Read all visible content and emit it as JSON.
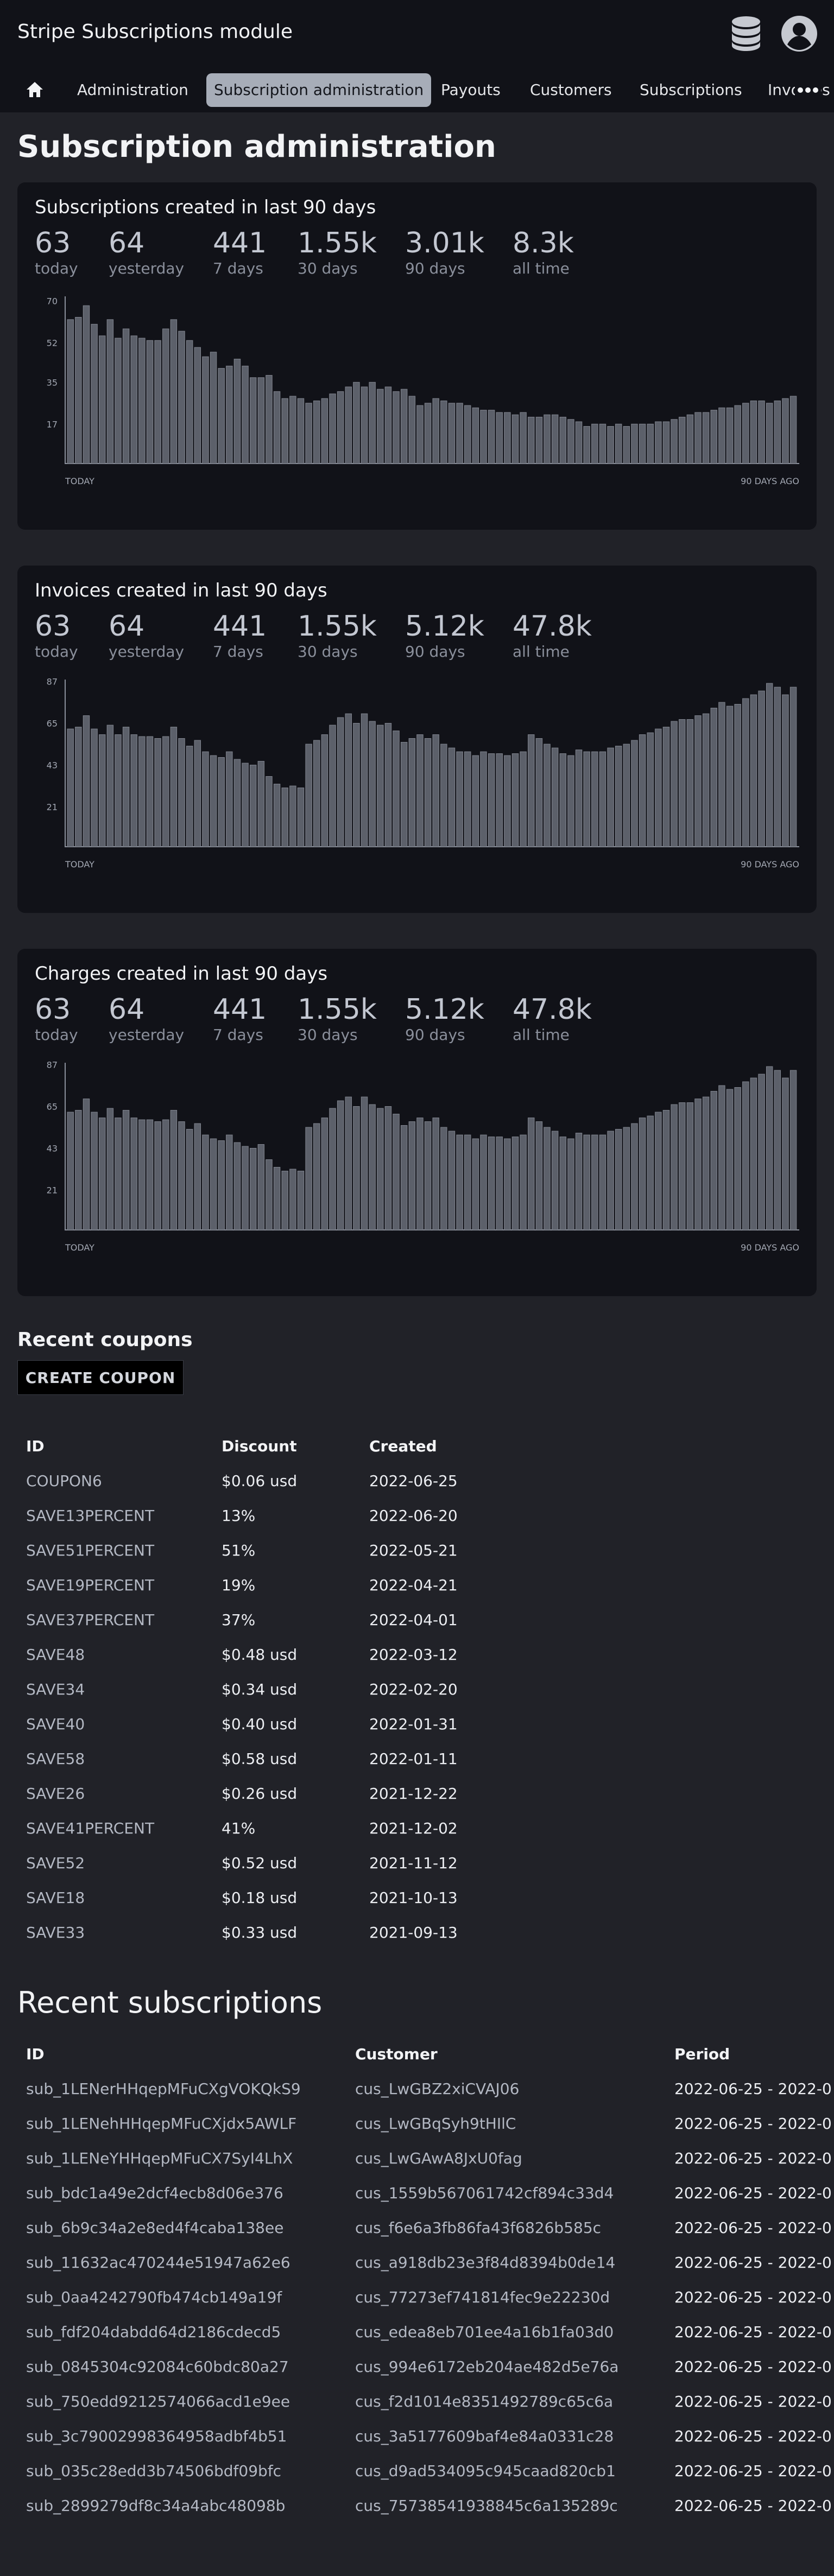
{
  "app": {
    "title": "Stripe Subscriptions module"
  },
  "icons": {
    "database": "database-icon",
    "account": "account-circle-icon",
    "home": "home-icon",
    "more": "more-horizontal-icon"
  },
  "nav": {
    "tabs": [
      "Administration",
      "Subscription administration",
      "Payouts",
      "Customers",
      "Subscriptions",
      "Invoices"
    ],
    "active_index": 1
  },
  "page": {
    "title": "Subscription administration"
  },
  "cards": [
    {
      "title": "Subscriptions created in last 90 days",
      "stats": [
        {
          "value": "63",
          "label": "today"
        },
        {
          "value": "64",
          "label": "yesterday"
        },
        {
          "value": "441",
          "label": "7 days"
        },
        {
          "value": "1.55k",
          "label": "30 days"
        },
        {
          "value": "3.01k",
          "label": "90 days"
        },
        {
          "value": "8.3k",
          "label": "all time"
        }
      ]
    },
    {
      "title": "Invoices created in last 90 days",
      "stats": [
        {
          "value": "63",
          "label": "today"
        },
        {
          "value": "64",
          "label": "yesterday"
        },
        {
          "value": "441",
          "label": "7 days"
        },
        {
          "value": "1.55k",
          "label": "30 days"
        },
        {
          "value": "5.12k",
          "label": "90 days"
        },
        {
          "value": "47.8k",
          "label": "all time"
        }
      ]
    },
    {
      "title": "Charges created in last 90 days",
      "stats": [
        {
          "value": "63",
          "label": "today"
        },
        {
          "value": "64",
          "label": "yesterday"
        },
        {
          "value": "441",
          "label": "7 days"
        },
        {
          "value": "1.55k",
          "label": "30 days"
        },
        {
          "value": "5.12k",
          "label": "90 days"
        },
        {
          "value": "47.8k",
          "label": "all time"
        }
      ]
    }
  ],
  "chart_data": [
    {
      "type": "bar",
      "xlabel_left": "TODAY",
      "xlabel_right": "90 DAYS AGO",
      "yticks": [
        17,
        35,
        52,
        70
      ],
      "ylim": [
        0,
        72
      ],
      "values": [
        62,
        63,
        68,
        60,
        55,
        62,
        54,
        58,
        55,
        54,
        53,
        53,
        58,
        62,
        57,
        53,
        50,
        46,
        48,
        41,
        42,
        45,
        42,
        37,
        37,
        38,
        31,
        28,
        29,
        28,
        26,
        27,
        28,
        30,
        31,
        33,
        35,
        33,
        35,
        32,
        33,
        31,
        32,
        29,
        25,
        26,
        28,
        27,
        26,
        26,
        25,
        24,
        23,
        23,
        22,
        22,
        21,
        22,
        20,
        20,
        21,
        21,
        20,
        19,
        18,
        16,
        17,
        17,
        16,
        17,
        16,
        17,
        17,
        17,
        18,
        18,
        19,
        20,
        21,
        22,
        22,
        23,
        24,
        24,
        25,
        26,
        27,
        27,
        26,
        27,
        28,
        29
      ]
    },
    {
      "type": "bar",
      "xlabel_left": "TODAY",
      "xlabel_right": "90 DAYS AGO",
      "yticks": [
        21,
        43,
        65,
        87
      ],
      "ylim": [
        0,
        88
      ],
      "values": [
        62,
        63,
        69,
        62,
        59,
        64,
        59,
        63,
        59,
        58,
        58,
        57,
        58,
        63,
        57,
        53,
        56,
        50,
        48,
        47,
        50,
        46,
        44,
        43,
        45,
        37,
        33,
        31,
        32,
        31,
        54,
        56,
        59,
        64,
        68,
        70,
        65,
        70,
        66,
        64,
        65,
        61,
        55,
        57,
        59,
        57,
        59,
        54,
        52,
        50,
        50,
        48,
        50,
        49,
        49,
        48,
        49,
        50,
        59,
        57,
        54,
        52,
        49,
        48,
        51,
        50,
        50,
        50,
        52,
        53,
        54,
        56,
        59,
        60,
        62,
        63,
        66,
        67,
        67,
        69,
        70,
        73,
        76,
        74,
        75,
        78,
        80,
        82,
        86,
        84,
        80,
        84
      ]
    },
    {
      "type": "bar",
      "xlabel_left": "TODAY",
      "xlabel_right": "90 DAYS AGO",
      "yticks": [
        21,
        43,
        65,
        87
      ],
      "ylim": [
        0,
        88
      ],
      "values": [
        62,
        63,
        69,
        62,
        59,
        64,
        59,
        63,
        59,
        58,
        58,
        57,
        58,
        63,
        57,
        53,
        56,
        50,
        48,
        47,
        50,
        46,
        44,
        43,
        45,
        37,
        33,
        31,
        32,
        31,
        54,
        56,
        59,
        64,
        68,
        70,
        65,
        70,
        66,
        64,
        65,
        61,
        55,
        57,
        59,
        57,
        59,
        54,
        52,
        50,
        50,
        48,
        50,
        49,
        49,
        48,
        49,
        50,
        59,
        57,
        54,
        52,
        49,
        48,
        51,
        50,
        50,
        50,
        52,
        53,
        54,
        56,
        59,
        60,
        62,
        63,
        66,
        67,
        67,
        69,
        70,
        73,
        76,
        74,
        75,
        78,
        80,
        82,
        86,
        84,
        80,
        84
      ]
    }
  ],
  "coupons": {
    "heading": "Recent coupons",
    "create_label": "CREATE COUPON",
    "columns": [
      "ID",
      "Discount",
      "Created"
    ],
    "rows": [
      [
        "COUPON6",
        "$0.06 usd",
        "2022-06-25"
      ],
      [
        "SAVE13PERCENT",
        "13%",
        "2022-06-20"
      ],
      [
        "SAVE51PERCENT",
        "51%",
        "2022-05-21"
      ],
      [
        "SAVE19PERCENT",
        "19%",
        "2022-04-21"
      ],
      [
        "SAVE37PERCENT",
        "37%",
        "2022-04-01"
      ],
      [
        "SAVE48",
        "$0.48 usd",
        "2022-03-12"
      ],
      [
        "SAVE34",
        "$0.34 usd",
        "2022-02-20"
      ],
      [
        "SAVE40",
        "$0.40 usd",
        "2022-01-31"
      ],
      [
        "SAVE58",
        "$0.58 usd",
        "2022-01-11"
      ],
      [
        "SAVE26",
        "$0.26 usd",
        "2021-12-22"
      ],
      [
        "SAVE41PERCENT",
        "41%",
        "2021-12-02"
      ],
      [
        "SAVE52",
        "$0.52 usd",
        "2021-11-12"
      ],
      [
        "SAVE18",
        "$0.18 usd",
        "2021-10-13"
      ],
      [
        "SAVE33",
        "$0.33 usd",
        "2021-09-13"
      ]
    ]
  },
  "subscriptions": {
    "heading": "Recent subscriptions",
    "columns": [
      "ID",
      "Customer",
      "Period"
    ],
    "rows": [
      [
        "sub_1LENerHHqepMFuCXgVOKQkS9",
        "cus_LwGBZ2xiCVAJ06",
        "2022-06-25 - 2022-0"
      ],
      [
        "sub_1LENehHHqepMFuCXjdx5AWLF",
        "cus_LwGBqSyh9tHIlC",
        "2022-06-25 - 2022-0"
      ],
      [
        "sub_1LENeYHHqepMFuCX7SyI4LhX",
        "cus_LwGAwA8JxU0fag",
        "2022-06-25 - 2022-0"
      ],
      [
        "sub_bdc1a49e2dcf4ecb8d06e376",
        "cus_1559b567061742cf894c33d4",
        "2022-06-25 - 2022-0"
      ],
      [
        "sub_6b9c34a2e8ed4f4caba138ee",
        "cus_f6e6a3fb86fa43f6826b585c",
        "2022-06-25 - 2022-0"
      ],
      [
        "sub_11632ac470244e51947a62e6",
        "cus_a918db23e3f84d8394b0de14",
        "2022-06-25 - 2022-0"
      ],
      [
        "sub_0aa4242790fb474cb149a19f",
        "cus_77273ef741814fec9e22230d",
        "2022-06-25 - 2022-0"
      ],
      [
        "sub_fdf204dabdd64d2186cdecd5",
        "cus_edea8eb701ee4a16b1fa03d0",
        "2022-06-25 - 2022-0"
      ],
      [
        "sub_0845304c92084c60bdc80a27",
        "cus_994e6172eb204ae482d5e76a",
        "2022-06-25 - 2022-0"
      ],
      [
        "sub_750edd9212574066acd1e9ee",
        "cus_f2d1014e8351492789c65c6a",
        "2022-06-25 - 2022-0"
      ],
      [
        "sub_3c79002998364958adbf4b51",
        "cus_3a5177609baf4e84a0331c28",
        "2022-06-25 - 2022-0"
      ],
      [
        "sub_035c28edd3b74506bdf09bfc",
        "cus_d9ad534095c945caad820cb1",
        "2022-06-25 - 2022-0"
      ],
      [
        "sub_2899279df8c34a4abc48098b",
        "cus_75738541938845c6a135289c",
        "2022-06-25 - 2022-0"
      ]
    ]
  }
}
